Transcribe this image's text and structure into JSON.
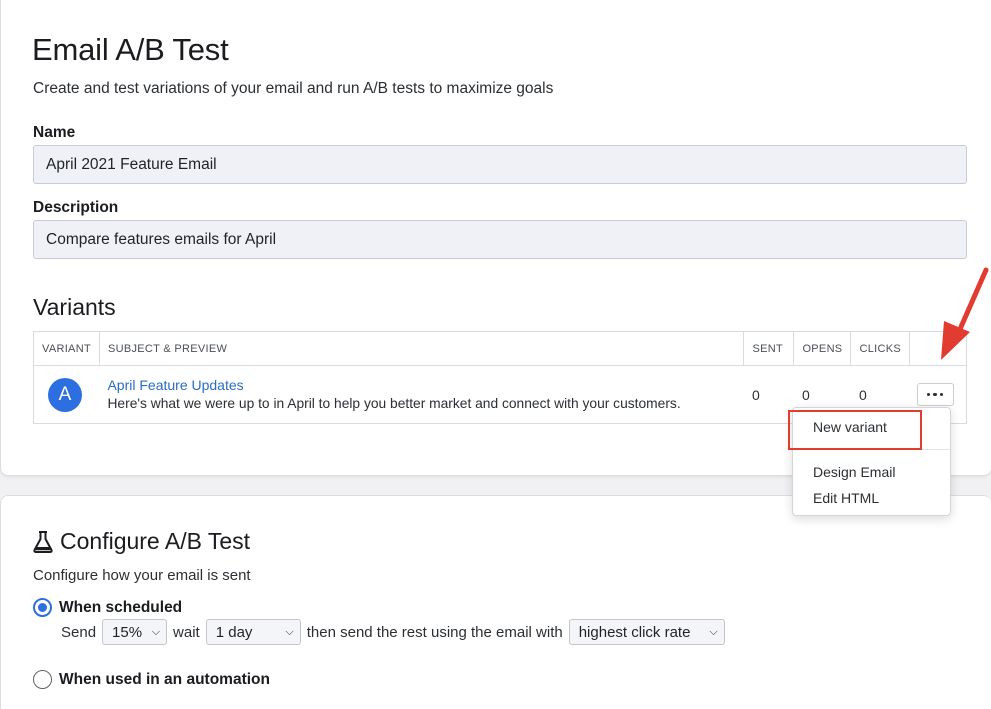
{
  "header": {
    "title": "Email A/B Test",
    "subtitle": "Create and test variations of your email and run A/B tests to maximize goals"
  },
  "form": {
    "name_label": "Name",
    "name_value": "April 2021 Feature Email",
    "description_label": "Description",
    "description_value": "Compare features emails for April"
  },
  "variants": {
    "title": "Variants",
    "columns": [
      "VARIANT",
      "SUBJECT & PREVIEW",
      "SENT",
      "OPENS",
      "CLICKS"
    ],
    "rows": [
      {
        "letter": "A",
        "subject": "April Feature Updates",
        "preview": "Here's what we were up to in April to help you better market and connect with your customers.",
        "sent": "0",
        "opens": "0",
        "clicks": "0"
      }
    ]
  },
  "menu": {
    "items": [
      "New variant",
      "Design Email",
      "Edit HTML"
    ]
  },
  "configure": {
    "title": "Configure A/B Test",
    "subtitle": "Configure how your email is sent",
    "option_scheduled": "When scheduled",
    "option_automation": "When used in an automation",
    "send_label": "Send",
    "send_percent": "15%",
    "wait_label": "wait",
    "wait_value": "1 day",
    "then_label": "then send the rest using the email with",
    "metric_value": "highest click rate"
  },
  "colors": {
    "accent": "#2d6fe0",
    "link": "#2a6cc4",
    "annotation": "#e23b2f"
  },
  "icons": {
    "more": "more-horizontal-icon",
    "flask": "flask-icon",
    "arrow": "red-arrow-annotation"
  }
}
